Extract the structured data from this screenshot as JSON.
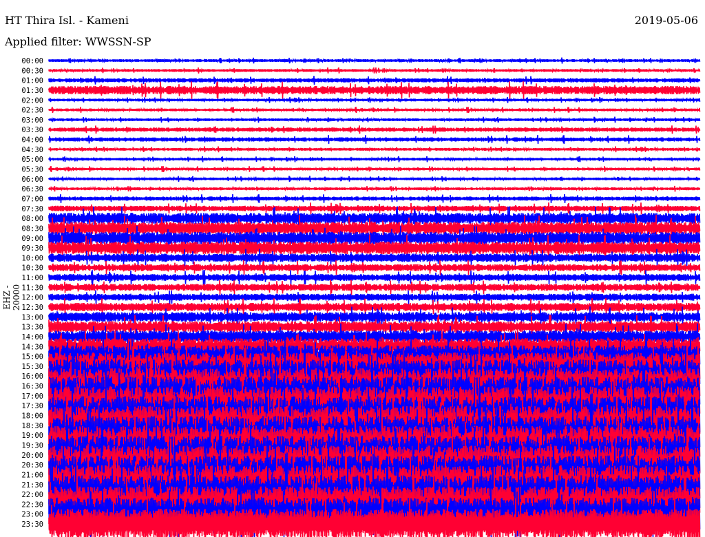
{
  "chart_data": {
    "type": "line",
    "title": "HT Thira Isl. - Kameni",
    "date": "2019-05-06",
    "subtitle": "Applied filter: WWSSN-SP",
    "ylabel": "EHZ - 20000",
    "xlabel": "",
    "trace_colors": [
      "#0000ff",
      "#ff0033"
    ],
    "ytick_labels": [
      "00:00",
      "00:30",
      "01:00",
      "01:30",
      "02:00",
      "02:30",
      "03:00",
      "03:30",
      "04:00",
      "04:30",
      "05:00",
      "05:30",
      "06:00",
      "06:30",
      "07:00",
      "07:30",
      "08:00",
      "08:30",
      "09:00",
      "09:30",
      "10:00",
      "10:30",
      "11:00",
      "11:30",
      "12:00",
      "12:30",
      "13:00",
      "13:30",
      "14:00",
      "14:30",
      "15:00",
      "15:30",
      "16:00",
      "16:30",
      "17:00",
      "17:30",
      "18:00",
      "18:30",
      "19:00",
      "19:30",
      "20:00",
      "20:30",
      "21:00",
      "21:30",
      "22:00",
      "22:30",
      "23:00",
      "23:30"
    ],
    "relative_amplitude": [
      2,
      2,
      3,
      6,
      2,
      2,
      2,
      3,
      3,
      2,
      2,
      2,
      2,
      2,
      3,
      4,
      8,
      9,
      9,
      9,
      6,
      5,
      5,
      5,
      5,
      6,
      7,
      8,
      9,
      12,
      16,
      20,
      24,
      26,
      28,
      28,
      28,
      28,
      28,
      28,
      28,
      28,
      28,
      28,
      28,
      26,
      24,
      22
    ],
    "minutes_per_line": 30
  }
}
